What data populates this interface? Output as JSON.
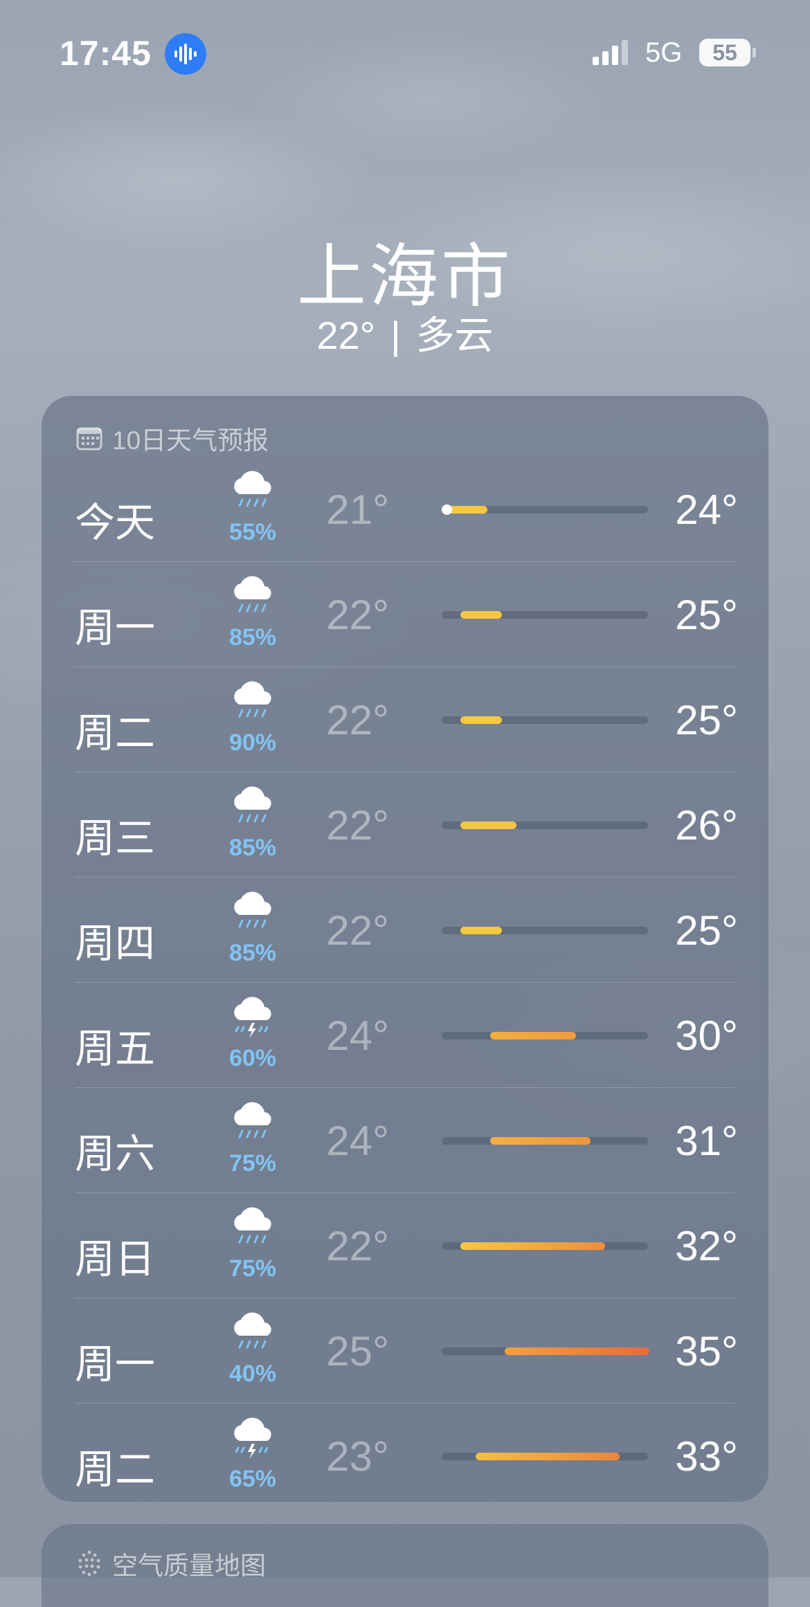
{
  "status_bar": {
    "time": "17:45",
    "network": "5G",
    "battery": "55"
  },
  "location": {
    "city": "上海市",
    "temperature": "22°",
    "condition": "多云"
  },
  "forecast": {
    "title": "10日天气预报",
    "range_min": 21,
    "range_max": 35,
    "current_temp": 22,
    "days": [
      {
        "day": "今天",
        "icon": "rain-icon",
        "precip": "55%",
        "low": "21°",
        "high": "24°",
        "low_val": 21,
        "high_val": 24,
        "color_start": "#f5c842",
        "color_end": "#f5c842",
        "current": true
      },
      {
        "day": "周一",
        "icon": "rain-icon",
        "precip": "85%",
        "low": "22°",
        "high": "25°",
        "low_val": 22,
        "high_val": 25,
        "color_start": "#f5c842",
        "color_end": "#f5c842"
      },
      {
        "day": "周二",
        "icon": "rain-icon",
        "precip": "90%",
        "low": "22°",
        "high": "25°",
        "low_val": 22,
        "high_val": 25,
        "color_start": "#f5c842",
        "color_end": "#f5c842"
      },
      {
        "day": "周三",
        "icon": "rain-icon",
        "precip": "85%",
        "low": "22°",
        "high": "26°",
        "low_val": 22,
        "high_val": 26,
        "color_start": "#f5c842",
        "color_end": "#f5c24a"
      },
      {
        "day": "周四",
        "icon": "rain-icon",
        "precip": "85%",
        "low": "22°",
        "high": "25°",
        "low_val": 22,
        "high_val": 25,
        "color_start": "#f5c842",
        "color_end": "#f5c842"
      },
      {
        "day": "周五",
        "icon": "thunderstorm-icon",
        "precip": "60%",
        "low": "24°",
        "high": "30°",
        "low_val": 24,
        "high_val": 30,
        "color_start": "#f3b040",
        "color_end": "#ef9a3e"
      },
      {
        "day": "周六",
        "icon": "rain-icon",
        "precip": "75%",
        "low": "24°",
        "high": "31°",
        "low_val": 24,
        "high_val": 31,
        "color_start": "#f3b040",
        "color_end": "#ee963c"
      },
      {
        "day": "周日",
        "icon": "rain-icon",
        "precip": "75%",
        "low": "22°",
        "high": "32°",
        "low_val": 22,
        "high_val": 32,
        "color_start": "#f5c842",
        "color_end": "#ee8f3c"
      },
      {
        "day": "周一",
        "icon": "rain-icon",
        "precip": "40%",
        "low": "25°",
        "high": "35°",
        "low_val": 25,
        "high_val": 35,
        "color_start": "#f2a23e",
        "color_end": "#ea6a3a"
      },
      {
        "day": "周二",
        "icon": "thunderstorm-icon",
        "precip": "65%",
        "low": "23°",
        "high": "33°",
        "low_val": 23,
        "high_val": 33,
        "color_start": "#f5bf42",
        "color_end": "#ee853c"
      }
    ]
  },
  "air_quality": {
    "title": "空气质量地图"
  }
}
